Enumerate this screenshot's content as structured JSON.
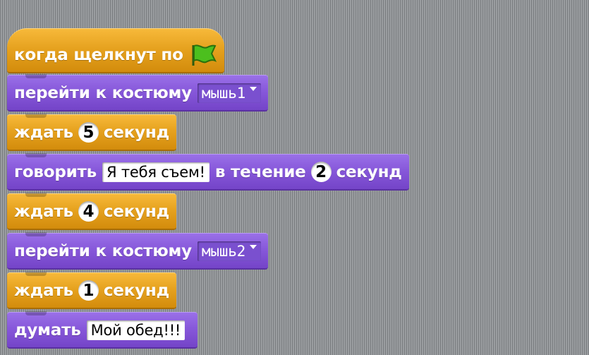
{
  "canvas": {
    "background": "#888b8e",
    "control_color": "#e6a21f",
    "looks_color": "#8758da"
  },
  "blocks": {
    "hat": {
      "label": "когда щелкнут по",
      "icon": "green-flag-icon"
    },
    "costume1": {
      "label": "перейти к костюму",
      "value": "мышь1"
    },
    "wait1": {
      "label": "ждать",
      "value": "5",
      "unit": "секунд"
    },
    "say": {
      "label": "говорить",
      "text": "Я тебя съем!",
      "mid_label": "в течение",
      "value": "2",
      "unit": "секунд"
    },
    "wait2": {
      "label": "ждать",
      "value": "4",
      "unit": "секунд"
    },
    "costume2": {
      "label": "перейти к костюму",
      "value": "мышь2"
    },
    "wait3": {
      "label": "ждать",
      "value": "1",
      "unit": "секунд"
    },
    "think": {
      "label": "думать",
      "text": "Мой обед!!!"
    }
  }
}
